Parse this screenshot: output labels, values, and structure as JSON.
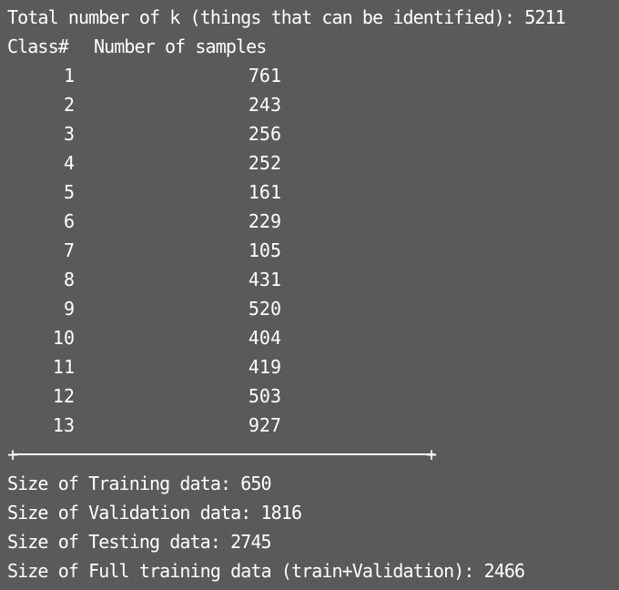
{
  "summary": {
    "total_line": "Total number of k (things that can be identified): 5211"
  },
  "table": {
    "header_class": "Class#",
    "header_samples": "Number of samples",
    "rows": [
      {
        "class": "1",
        "samples": "761"
      },
      {
        "class": "2",
        "samples": "243"
      },
      {
        "class": "3",
        "samples": "256"
      },
      {
        "class": "4",
        "samples": "252"
      },
      {
        "class": "5",
        "samples": "161"
      },
      {
        "class": "6",
        "samples": "229"
      },
      {
        "class": "7",
        "samples": "105"
      },
      {
        "class": "8",
        "samples": "431"
      },
      {
        "class": "9",
        "samples": "520"
      },
      {
        "class": "10",
        "samples": "404"
      },
      {
        "class": "11",
        "samples": "419"
      },
      {
        "class": "12",
        "samples": "503"
      },
      {
        "class": "13",
        "samples": "927"
      }
    ]
  },
  "separator": {
    "corner_glyph": "+"
  },
  "sizes": {
    "training": "Size of Training data: 650",
    "validation": "Size of Validation data: 1816",
    "testing": "Size of Testing data: 2745",
    "full_training": "Size of Full training data (train+Validation): 2466"
  },
  "colors": {
    "background": "#5a5a5a",
    "text": "#ffffff"
  }
}
